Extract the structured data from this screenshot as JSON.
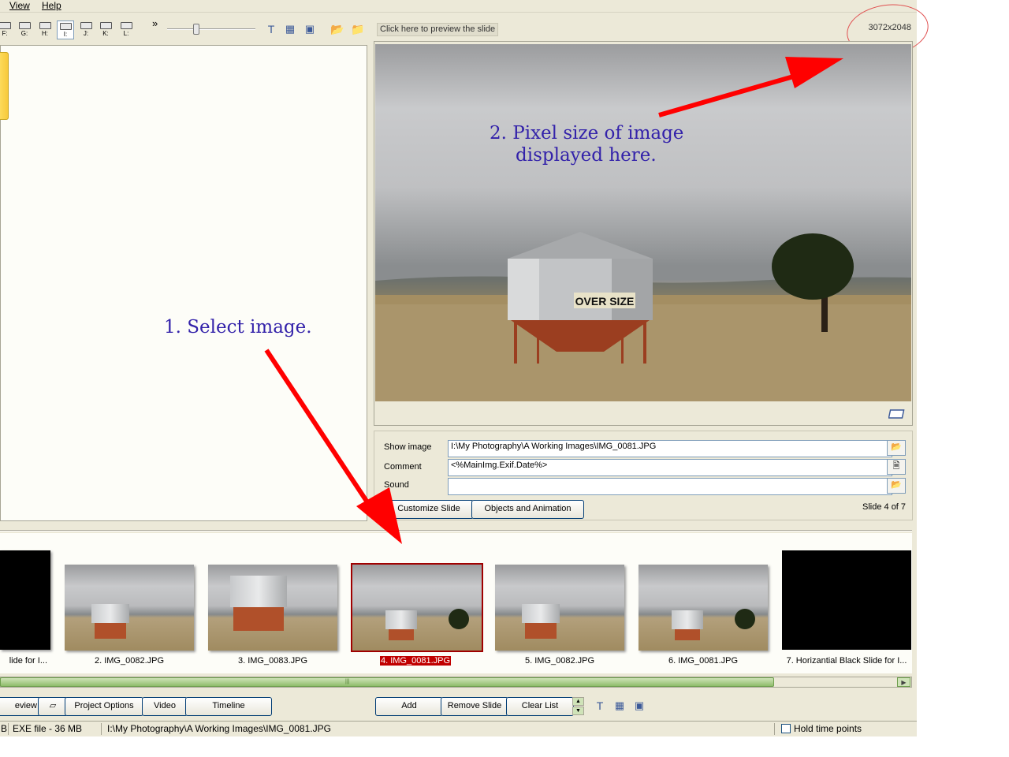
{
  "menu": {
    "view": "View",
    "help": "Help"
  },
  "toolbar": {
    "drives": [
      "F:",
      "G:",
      "H:",
      "I:",
      "J:",
      "K:",
      "L:"
    ],
    "selected_drive": "I:",
    "more": "»"
  },
  "preview": {
    "link": "Click here to preview the slide",
    "image_size": "3072x2048"
  },
  "properties": {
    "show_image_label": "Show image",
    "show_image_value": "I:\\My Photography\\A Working Images\\IMG_0081.JPG",
    "comment_label": "Comment",
    "comment_value": "<%MainImg.Exif.Date%>",
    "sound_label": "Sound",
    "sound_value": "",
    "customize_button": "Customize Slide",
    "objects_button": "Objects and Animation",
    "slide_counter": "Slide 4 of 7"
  },
  "thumbnails": [
    {
      "caption": "lide for I...",
      "kind": "black"
    },
    {
      "caption": "2. IMG_0082.JPG",
      "kind": "photo"
    },
    {
      "caption": "3. IMG_0083.JPG",
      "kind": "photo"
    },
    {
      "caption": "4. IMG_0081.JPG",
      "kind": "photo",
      "selected": true
    },
    {
      "caption": "5. IMG_0082.JPG",
      "kind": "photo"
    },
    {
      "caption": "6. IMG_0081.JPG",
      "kind": "photo"
    },
    {
      "caption": "7. Horizantial Black Slide for I...",
      "kind": "black"
    }
  ],
  "bottom_buttons": {
    "preview": "eview",
    "project_options": "Project Options",
    "video": "Video",
    "timeline": "Timeline",
    "add": "Add",
    "remove_slide": "Remove Slide",
    "clear_list": "Clear List"
  },
  "status": {
    "left": "B",
    "exe": "EXE file - 36 MB",
    "path": "I:\\My Photography\\A Working Images\\IMG_0081.JPG",
    "hold_time_points": "Hold time points"
  },
  "annotations": {
    "step1": "1. Select image.",
    "step2_line1": "2. Pixel size of image",
    "step2_line2": "displayed here."
  },
  "photo_text": "OVER SIZE",
  "colors": {
    "annotation_text": "#3322aa",
    "arrow": "#ff0000",
    "selection": "#c00000"
  }
}
